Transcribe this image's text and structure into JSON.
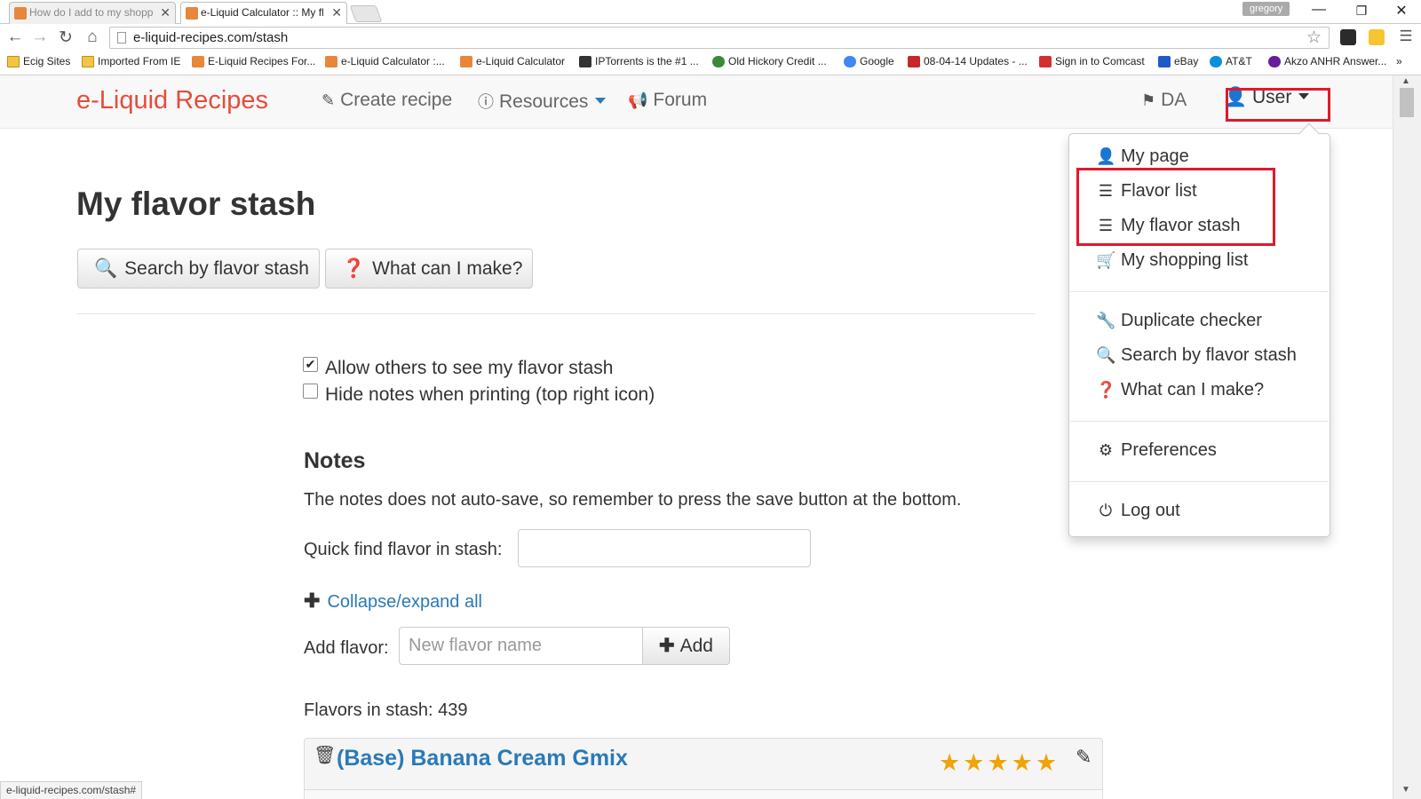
{
  "browser": {
    "tabs": [
      {
        "title": "How do I add to my shopp"
      },
      {
        "title": "e-Liquid Calculator :: My fl"
      }
    ],
    "profile_name": "gregory",
    "url": "e-liquid-recipes.com/stash",
    "bookmarks": [
      "Ecig Sites",
      "Imported From IE",
      "E-Liquid Recipes For...",
      "e-Liquid Calculator :...",
      "e-Liquid Calculator",
      "IPTorrents is the #1 ...",
      "Old Hickory Credit ...",
      "Google",
      "08-04-14 Updates - ...",
      "Sign in to Comcast",
      "eBay",
      "AT&T",
      "Akzo ANHR Answer..."
    ],
    "status_url": "e-liquid-recipes.com/stash#"
  },
  "site": {
    "brand": "e-Liquid Recipes",
    "nav": {
      "create": "Create recipe",
      "resources": "Resources",
      "forum": "Forum",
      "lang": "DA",
      "user": "User"
    },
    "user_menu": [
      {
        "label": "My page",
        "icon": "user-icon"
      },
      {
        "label": "Flavor list",
        "icon": "list-icon"
      },
      {
        "label": "My flavor stash",
        "icon": "list-icon"
      },
      {
        "label": "My shopping list",
        "icon": "cart-icon"
      },
      {
        "label": "Duplicate checker",
        "icon": "wrench-icon"
      },
      {
        "label": "Search by flavor stash",
        "icon": "search-icon"
      },
      {
        "label": "What can I make?",
        "icon": "question-icon"
      },
      {
        "label": "Preferences",
        "icon": "gear-icon"
      },
      {
        "label": "Log out",
        "icon": "power-icon"
      }
    ]
  },
  "page": {
    "title": "My flavor stash",
    "buttons": {
      "search_stash": "Search by flavor stash",
      "what_can_i_make": "What can I make?"
    },
    "options": {
      "allow_others": "Allow others to see my flavor stash",
      "allow_others_checked": true,
      "hide_notes": "Hide notes when printing (top right icon)",
      "hide_notes_checked": false
    },
    "notes": {
      "heading": "Notes",
      "description": "The notes does not auto-save, so remember to press the save button at the bottom.",
      "quick_find_label": "Quick find flavor in stash:",
      "quick_find_value": "",
      "collapse_label": "Collapse/expand all",
      "add_flavor_label": "Add flavor:",
      "add_flavor_placeholder": "New flavor name",
      "add_button": "Add"
    },
    "flavors_count_label": "Flavors in stash: 439",
    "flavors": [
      {
        "name": "(Base) Banana Cream Gmix",
        "rating": 5
      }
    ]
  },
  "colors": {
    "brand": "#e74c3c",
    "link": "#2a7ab8",
    "highlight_box": "#e0192b",
    "star": "#f0a30a"
  }
}
